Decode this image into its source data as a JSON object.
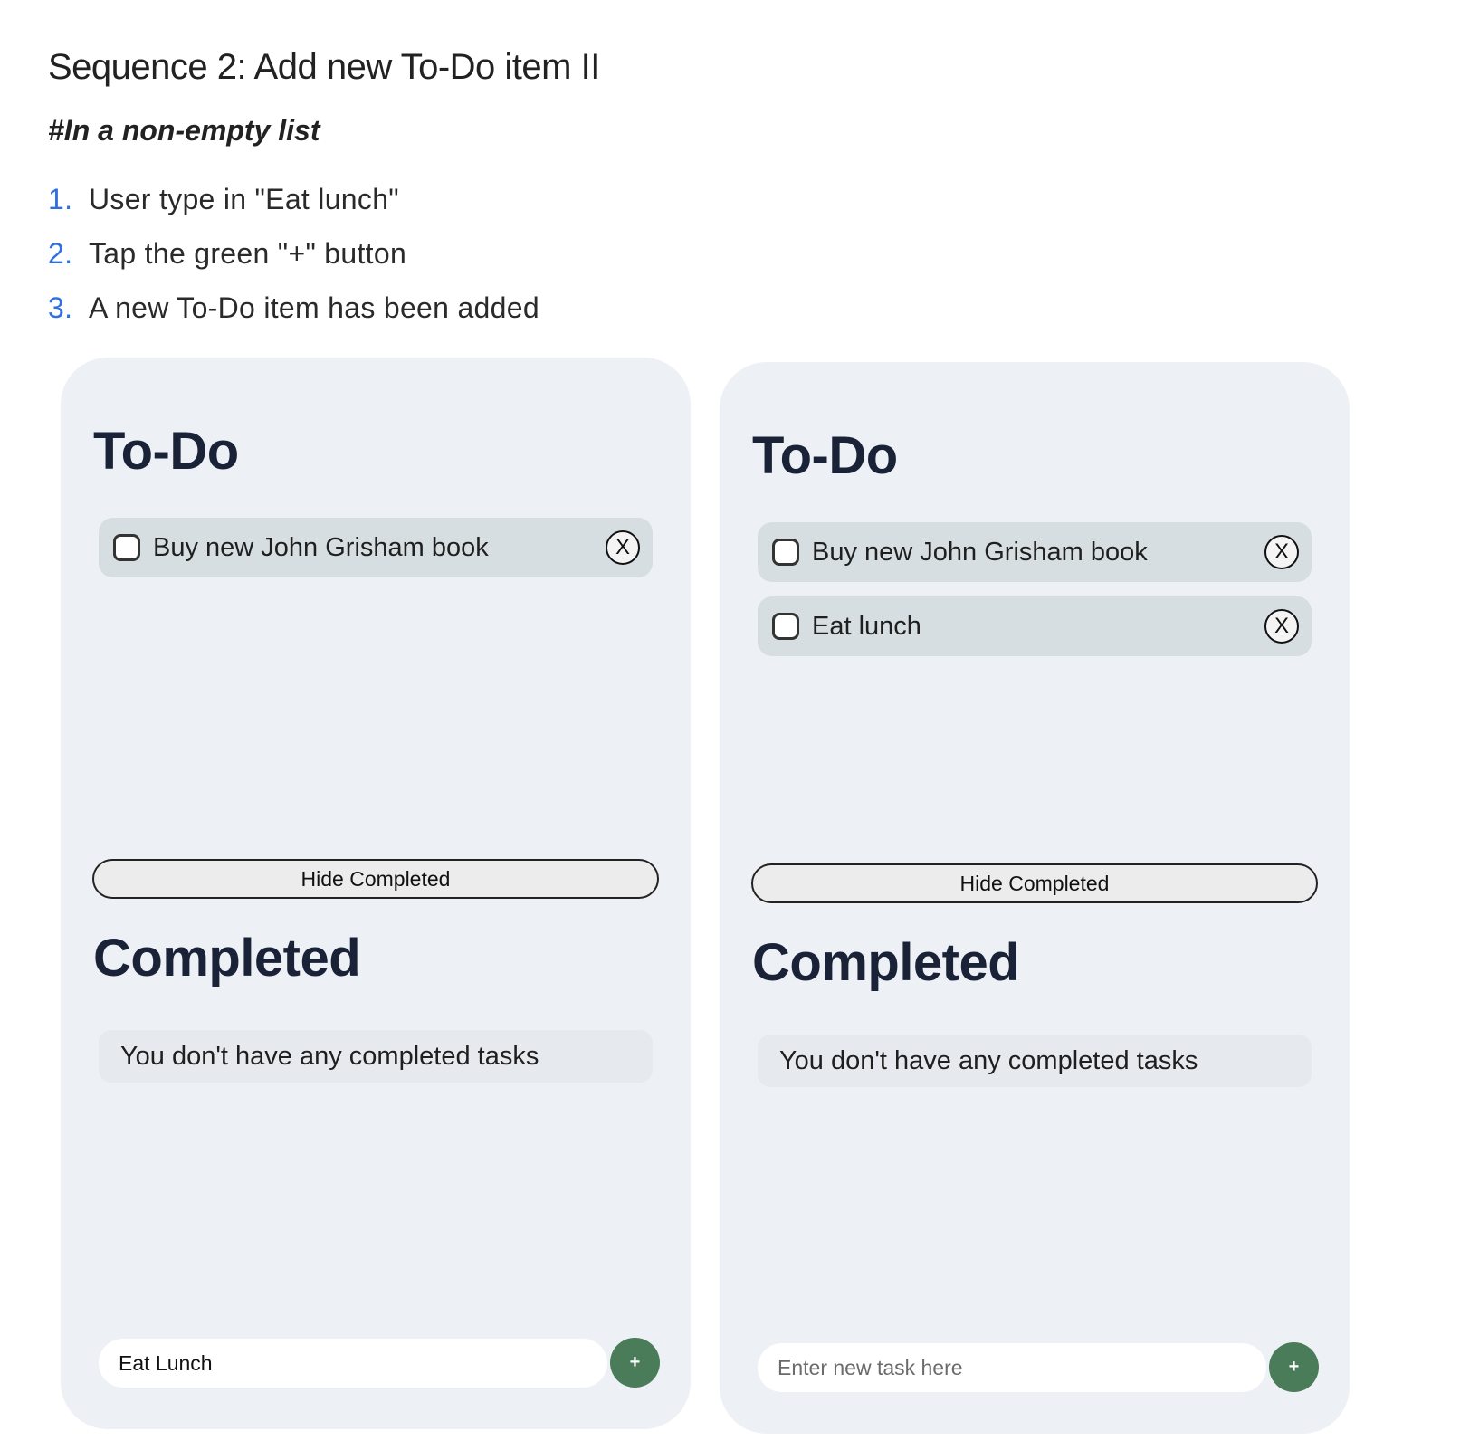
{
  "doc": {
    "title": "Sequence 2: Add new To-Do item II",
    "subtitle": "#In a non-empty list",
    "steps": [
      {
        "num": "1.",
        "text": "User type in \"Eat lunch\""
      },
      {
        "num": "2.",
        "text": "Tap the green \"+\" button"
      },
      {
        "num": "3.",
        "text": "A new To-Do item has been added"
      }
    ]
  },
  "colors": {
    "panel_bg": "#edf0f5",
    "task_item_bg": "#d6dee2",
    "heading": "#1a2238",
    "step_number": "#2f6fe0",
    "add_button": "#4a7c59"
  },
  "panels": [
    {
      "todo_heading": "To-Do",
      "tasks": [
        {
          "label": "Buy new John Grisham book",
          "checked": false,
          "delete_label": "X"
        }
      ],
      "hide_completed_label": "Hide Completed",
      "completed_heading": "Completed",
      "empty_message": "You don't have any completed tasks",
      "input": {
        "value": "Eat Lunch",
        "placeholder": "Enter new task here"
      },
      "add_label": "+"
    },
    {
      "todo_heading": "To-Do",
      "tasks": [
        {
          "label": "Buy new John Grisham book",
          "checked": false,
          "delete_label": "X"
        },
        {
          "label": "Eat lunch",
          "checked": false,
          "delete_label": "X"
        }
      ],
      "hide_completed_label": "Hide Completed",
      "completed_heading": "Completed",
      "empty_message": "You don't have any completed tasks",
      "input": {
        "value": "",
        "placeholder": "Enter new task here"
      },
      "add_label": "+"
    }
  ]
}
